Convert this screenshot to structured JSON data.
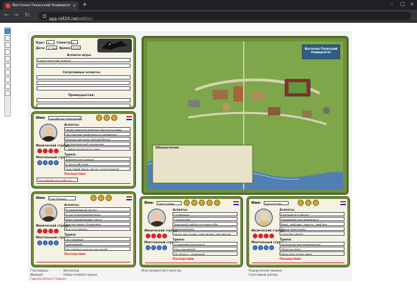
{
  "browser": {
    "tab_title": "Восточно-Техасский Университ",
    "url_host": "app.roll20.net",
    "url_path": "/editor/"
  },
  "top_sheet": {
    "kurs_label": "Курс:",
    "kurs_value": "1",
    "semestr_label": "Семестр:",
    "semestr_value": "2",
    "data_label": "Дата:",
    "data_value": "17 мая",
    "vremya_label": "Время:",
    "vremya_value": "20:00",
    "aspects_game_label": "Аспекты игры:",
    "aspect_game_1": "Скоро зачетная неделя",
    "situational_label": "Ситуативные аспекты:",
    "advantages_label": "Преимущества:"
  },
  "map": {
    "title": "Восточно-Техасский Университет",
    "legend_title": "Обозначения"
  },
  "cards": [
    {
      "name_label": "Имя:",
      "name": "Арчибальд Равенкрофт",
      "aspects_label": "Аспекты:",
      "aspects": [
        "Представитель древнего богатого рода",
        "Постоянные проблемы со здоровьем",
        "Изучает ритуалы тёмной Магии",
        "Патологический неудачник",
        "...ваша всегда есть план"
      ],
      "phys_label": "Физический стресс:",
      "ment_label": "Ментальный стресс:",
      "tricks_label": "Трюки:",
      "tricks": [
        "Архитектура сердца",
        "Я читал об этом!",
        "Трастовый фонд, датчи: уплотнения 6"
      ],
      "consequences_label": "Последствия:",
      "consequence": "Отставание по учёбе (2)"
    },
    {
      "name_label": "Имя:",
      "name": "Кэр Мэддер",
      "aspects_label": "Аспекты:",
      "aspects": [
        "Взламывающий артист",
        "Устал в незнакомое кино",
        "Вера поддерживает меня",
        "Всегда помогу ближнему",
        "Все пути верны"
      ],
      "phys_label": "Физический стресс:",
      "ment_label": "Ментальный стресс:",
      "tricks_label": "Трюки:",
      "tricks": [
        "Неутомимый",
        "Харизмадой",
        "Инструмент всегда под рукой"
      ],
      "consequences_label": "Последствия:",
      "consequence": ""
    },
    {
      "name_label": "Имя:",
      "name": "Лиза Клайд",
      "aspects_label": "Аспекты:",
      "aspects": [
        "Готовящая",
        "Генератива",
        "Защищай слабых не щадя себя",
        "Природоведка",
        "Хотят как лучше, получилось как всегда"
      ],
      "phys_label": "Физический стресс:",
      "ment_label": "Ментальный стресс:",
      "tricks_label": "Трюки:",
      "tricks": [
        "Отлаживая контракта",
        "Неустрашимый",
        "Но ничего с природой"
      ],
      "consequences_label": "Последствия:",
      "consequence": ""
    },
    {
      "name_label": "Имя:",
      "name": "Кельга Рэйх",
      "aspects_label": "Аспекты:",
      "aspects": [
        "Блондинка в законе",
        "Нерадивый дар медиалога",
        "Вера - мой щит, просто - мой меч",
        "Маски простушки",
        "Отец бес имени"
      ],
      "phys_label": "Физический стресс:",
      "ment_label": "Ментальный стресс:",
      "tricks_label": "Трюки:",
      "tricks": [
        "Не будь во мне инквизитора",
        "Объясни меня",
        "Дорогами чужих мира"
      ],
      "consequences_label": "Последствия:",
      "consequence": ""
    }
  ],
  "bottom": {
    "col1": [
      "Глоссофоры",
      "Имморит"
    ],
    "col2": [
      "Вагоколед",
      "Набор полового ящика"
    ],
    "red_link": "Горатка Белого Главаня",
    "col3": [
      "Ипы неизвестного монстра"
    ],
    "col4": [
      "Подкрученная машина",
      "Счастливый доплар"
    ]
  }
}
